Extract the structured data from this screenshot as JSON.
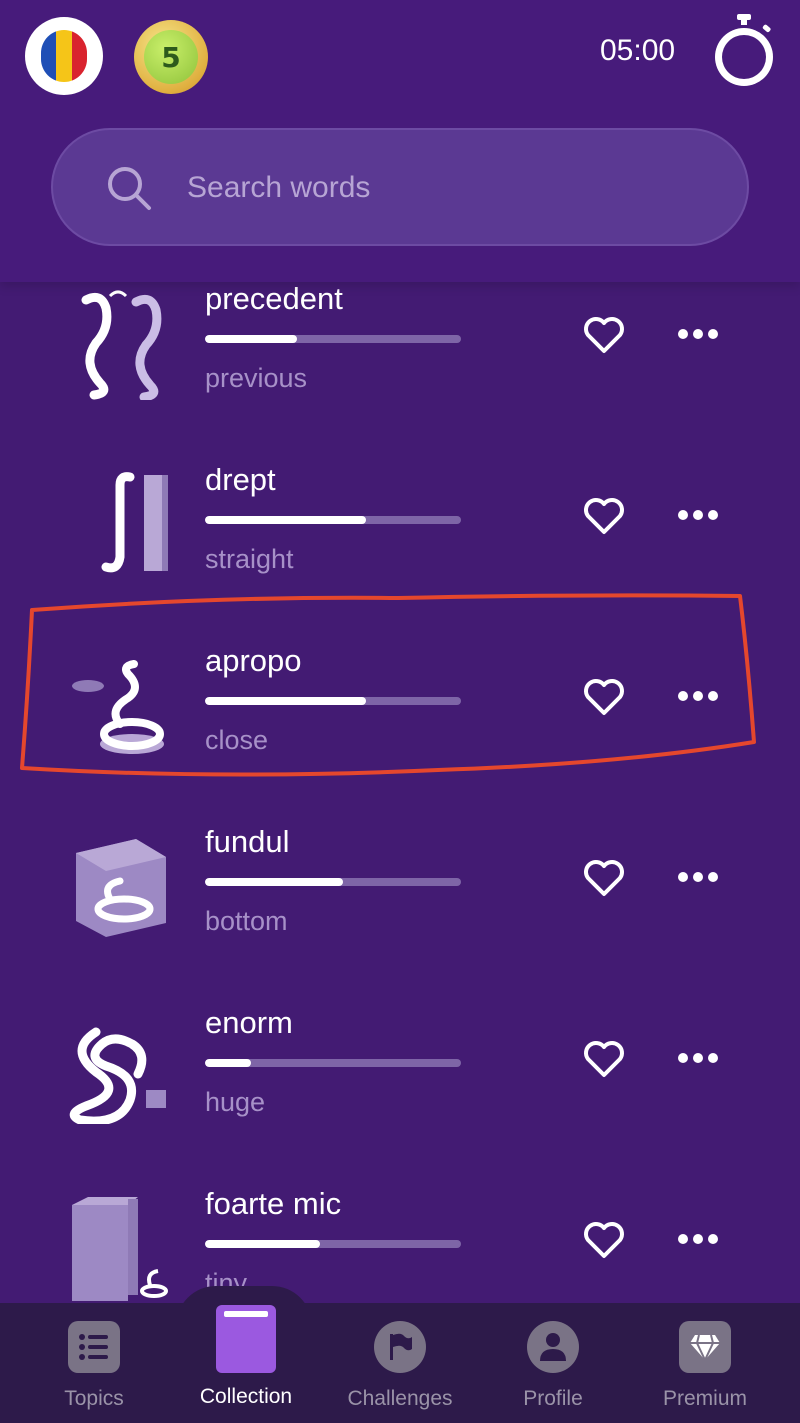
{
  "header": {
    "flag_colors": [
      "#1f4fb6",
      "#f5c518",
      "#d9232e"
    ],
    "level_badge": "5",
    "timer": "05:00",
    "search_placeholder": "Search words"
  },
  "words": [
    {
      "word": "precedent",
      "translation": "previous",
      "progress": 0.36,
      "thumb_icon": "two-snakes-icon"
    },
    {
      "word": "drept",
      "translation": "straight",
      "progress": 0.63,
      "thumb_icon": "straight-snake-icon"
    },
    {
      "word": "apropo",
      "translation": "close",
      "progress": 0.63,
      "thumb_icon": "coiled-snake-icon"
    },
    {
      "word": "fundul",
      "translation": "bottom",
      "progress": 0.54,
      "thumb_icon": "snake-in-box-icon"
    },
    {
      "word": "enorm",
      "translation": "huge",
      "progress": 0.18,
      "thumb_icon": "big-snake-icon"
    },
    {
      "word": "foarte mic",
      "translation": "tiny",
      "progress": 0.45,
      "thumb_icon": "box-small-snake-icon"
    }
  ],
  "nav": [
    {
      "label": "Topics",
      "icon": "list-icon"
    },
    {
      "label": "Collection",
      "icon": "book-icon",
      "active": true
    },
    {
      "label": "Challenges",
      "icon": "flag-icon"
    },
    {
      "label": "Profile",
      "icon": "person-icon"
    },
    {
      "label": "Premium",
      "icon": "diamond-icon"
    }
  ],
  "colors": {
    "background": "#431b73",
    "highlight": "#e5472d",
    "nav_active": "#9b59e0"
  }
}
